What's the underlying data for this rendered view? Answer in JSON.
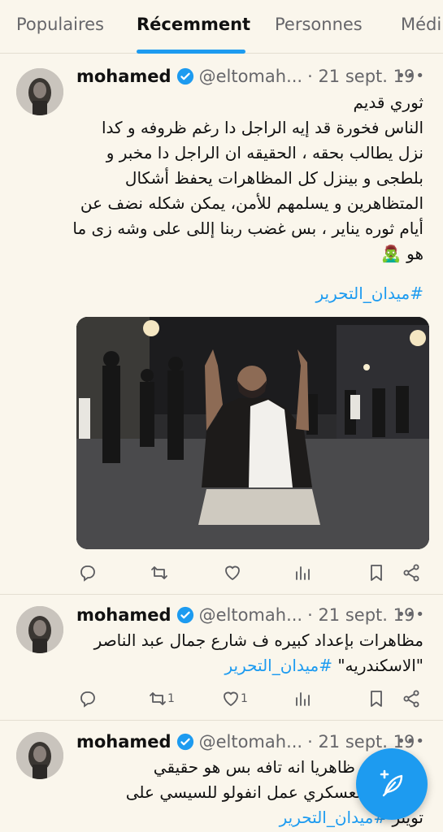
{
  "tabs": [
    {
      "label": "Populaires"
    },
    {
      "label": "Récemment"
    },
    {
      "label": "Personnes"
    },
    {
      "label": "Médi"
    }
  ],
  "colors": {
    "accent": "#1d9bf0",
    "background": "#faf6ec",
    "secondary_text": "#66666a"
  },
  "tweets": [
    {
      "name": "mohamed",
      "handle": "@eltomah...",
      "date": "· 21 sept. 19",
      "lines": [
        "ثوري قديم",
        "الناس فخورة قد إيه الراجل دا رغم ظروفه و كدا",
        "نزل يطالب بحقه ، الحقيقه ان الراجل دا مخبر و",
        "بلطجى و بينزل كل المظاهرات يحفظ أشكال",
        "المتظاهرين و يسلمهم للأمن، يمكن شكله نضف عن",
        "أيام ثوره يناير ، بس غضب ربنا إللى على وشه زى ما",
        "هو 🧟‍♂️"
      ],
      "hashtag": "#ميدان_التحرير",
      "retweet_count": "",
      "like_count": ""
    },
    {
      "name": "mohamed",
      "handle": "@eltomah...",
      "date": "· 21 sept. 19",
      "line1": "مظاهرات بإعداد كبيره ف شارع جمال عبد الناصر",
      "line2_text": "\"الاسكندريه\" ",
      "hashtag": "#ميدان_التحرير",
      "retweet_count": "1",
      "like_count": "1"
    },
    {
      "name": "mohamed",
      "handle": "@eltomah...",
      "date": "· 21 sept. 19",
      "line1": "هـ   ـر يبدو ظاهريا انه تافه بس هو حقيقي",
      "line2": "مـ   حدث العسكري عمل انفولو للسيسي على",
      "line3_text": "تويتر ",
      "hashtag": "#ميدان_التحرير"
    }
  ]
}
